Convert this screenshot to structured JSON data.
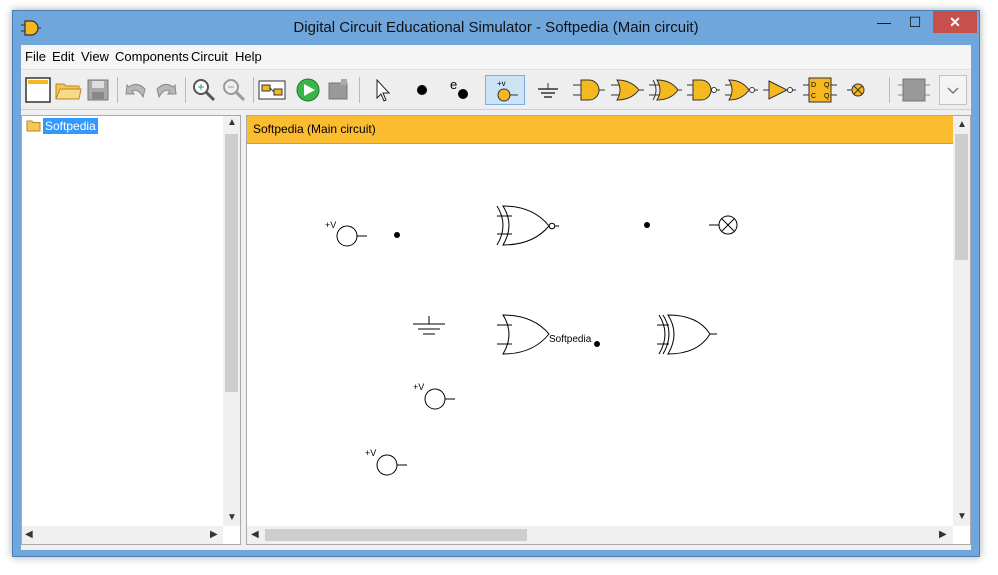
{
  "window": {
    "title": "Digital Circuit Educational Simulator -  Softpedia  (Main circuit)",
    "min_glyph": "—",
    "max_glyph": "☐",
    "close_glyph": "✕"
  },
  "menu": [
    "File",
    "Edit",
    "View",
    "Components",
    "Circuit",
    "Help"
  ],
  "toolbar": {
    "buttons": [
      "new-file-icon",
      "open-folder-icon",
      "save-disk-icon",
      "undo-icon",
      "redo-icon",
      "zoom-in-icon",
      "zoom-out-icon",
      "subcircuit-icon",
      "run-icon",
      "stop-icon",
      "pointer-icon",
      "node-icon",
      "input-pin-icon",
      "voltage-source-icon",
      "ground-icon",
      "and-gate-icon",
      "or-gate-icon",
      "xor-gate-icon",
      "nand-gate-icon",
      "nor-gate-icon",
      "not-gate-icon",
      "d-flipflop-icon",
      "lamp-icon",
      "chip-icon",
      "dropdown-icon"
    ],
    "active": "voltage-source-icon",
    "input_pin_letter": "e",
    "voltage_label": "+v",
    "flipflop_letters": [
      "D",
      "Q",
      "C",
      "Q"
    ]
  },
  "tree": {
    "root_label": "Softpedia"
  },
  "canvas": {
    "tab_title": "Softpedia (Main circuit)",
    "gate_label": "Softpedia",
    "voltage_label": "+V"
  },
  "colors": {
    "accent_header": "#fbbc31",
    "selection": "#3399ff",
    "window_frame": "#6fa6dc",
    "close_button": "#c7504a"
  }
}
